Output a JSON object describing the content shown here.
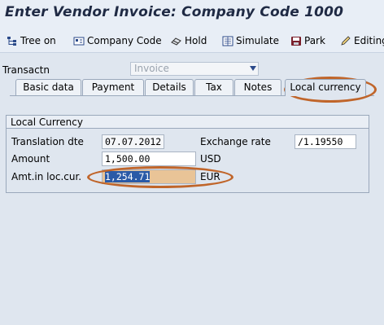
{
  "window": {
    "title": "Enter Vendor Invoice: Company Code 1000"
  },
  "toolbar": {
    "items": [
      {
        "label": "Tree on",
        "icon": "tree-icon"
      },
      {
        "label": "Company Code",
        "icon": "company-code-icon"
      },
      {
        "label": "Hold",
        "icon": "hold-icon"
      },
      {
        "label": "Simulate",
        "icon": "simulate-icon"
      },
      {
        "label": "Park",
        "icon": "park-icon"
      },
      {
        "label": "Editing",
        "icon": "pencil-icon"
      }
    ]
  },
  "transaction": {
    "label": "Transactn",
    "value": "Invoice"
  },
  "tabs": [
    {
      "label": "Basic data"
    },
    {
      "label": "Payment"
    },
    {
      "label": "Details"
    },
    {
      "label": "Tax"
    },
    {
      "label": "Notes"
    },
    {
      "label": "Local currency",
      "active": true
    }
  ],
  "local_currency": {
    "group_title": "Local Currency",
    "translation_date": {
      "label": "Translation dte",
      "value": "07.07.2012"
    },
    "exchange_rate": {
      "label": "Exchange rate",
      "value": "/1.19550"
    },
    "amount": {
      "label": "Amount",
      "value": "1,500.00",
      "currency": "USD"
    },
    "amount_local": {
      "label": "Amt.in loc.cur.",
      "value": "1,254.71",
      "currency": "EUR"
    }
  },
  "colors": {
    "highlight_ring": "#c0652a",
    "highlight_fill": "#e9c497",
    "selection": "#2a5aa7"
  }
}
